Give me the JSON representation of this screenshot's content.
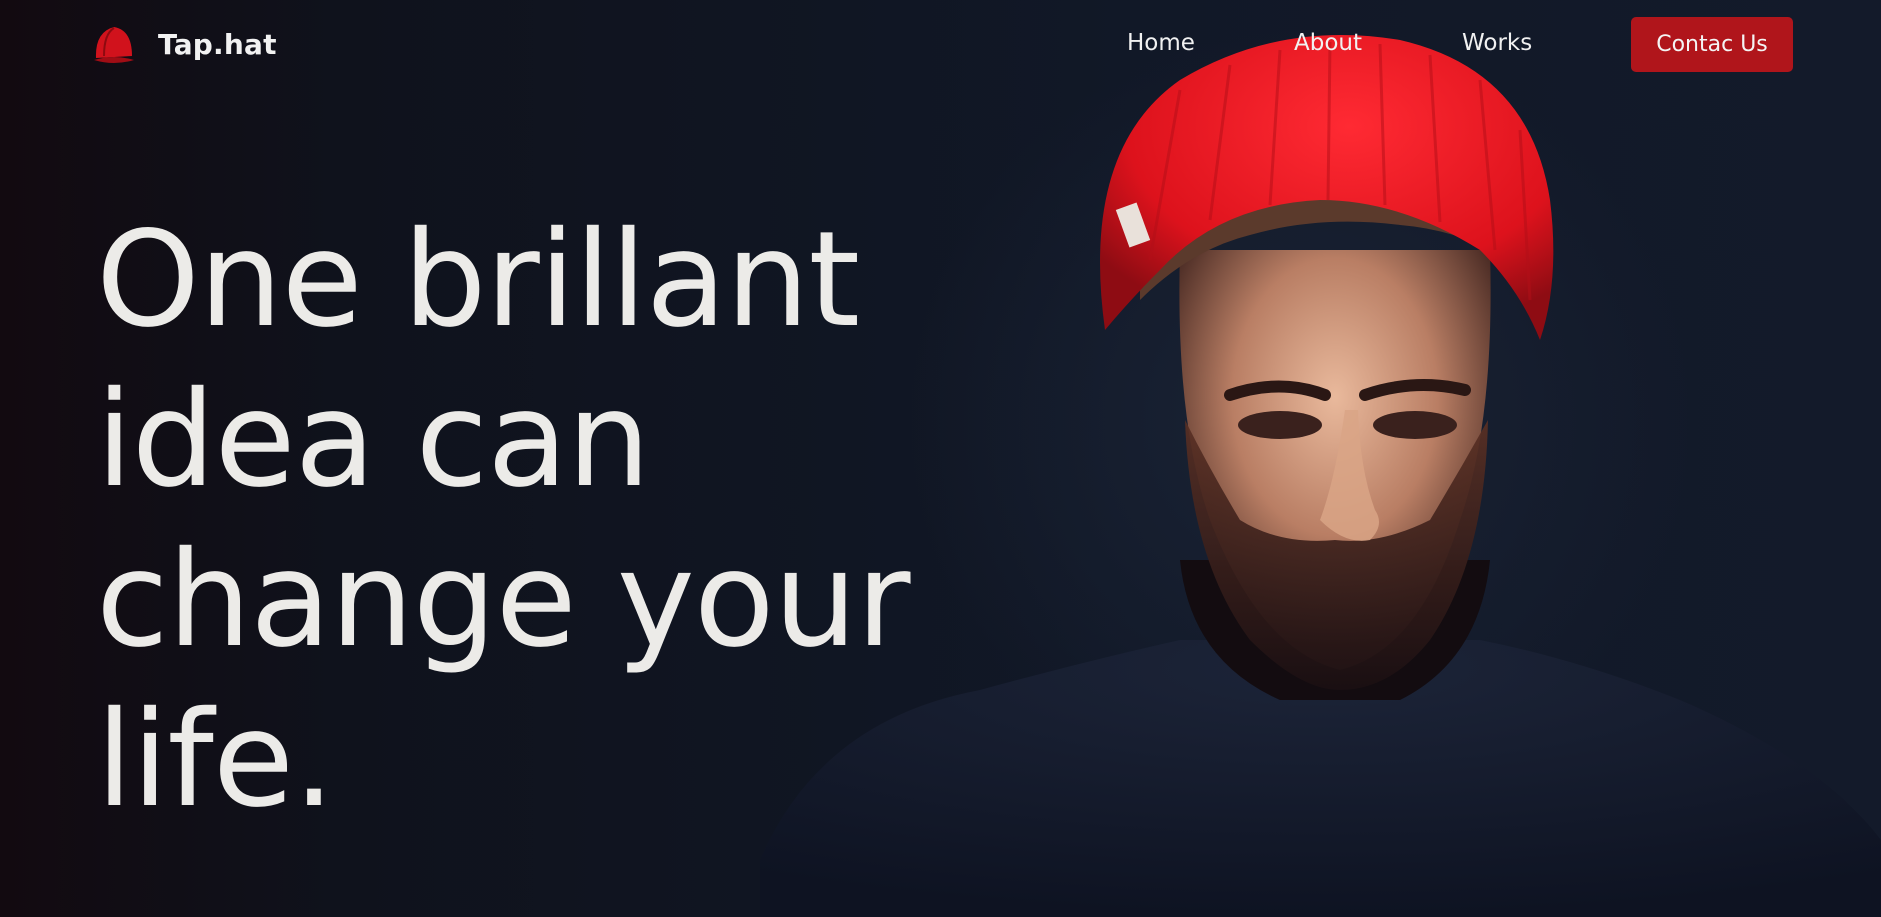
{
  "brand": {
    "name": "Tap.hat",
    "icon": "red-cap-icon"
  },
  "nav": {
    "links": [
      {
        "label": "Home"
      },
      {
        "label": "About"
      },
      {
        "label": "Works"
      }
    ],
    "cta_label": "Contac Us"
  },
  "hero": {
    "headline_lines": [
      "One brillant",
      "idea can",
      "change your",
      "life."
    ],
    "image": "man-in-red-beanie-photo"
  },
  "colors": {
    "accent": "#b0151b",
    "beanie": "#e0141f",
    "background": "#0f131c",
    "text": "#ecebe8"
  }
}
